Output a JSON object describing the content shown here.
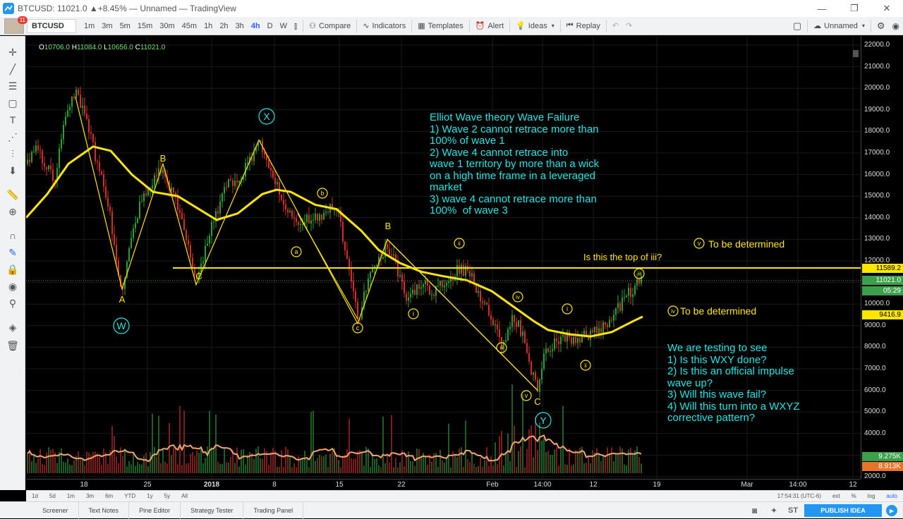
{
  "window": {
    "title": "BTCUSD: 11021.0 ▲+8.45% — Unnamed — TradingView",
    "minimize": "—",
    "maximize": "❐",
    "close": "✕"
  },
  "account": {
    "notification_count": "11"
  },
  "toolbar": {
    "symbol": "BTCUSD",
    "intervals": [
      "1m",
      "3m",
      "5m",
      "15m",
      "30m",
      "45m",
      "1h",
      "2h",
      "3h",
      "4h",
      "D",
      "W"
    ],
    "active_interval": "4h",
    "compare": "Compare",
    "indicators": "Indicators",
    "templates": "Templates",
    "alert": "Alert",
    "ideas": "Ideas",
    "replay": "Replay",
    "layout_name": "Unnamed"
  },
  "legend": {
    "o": "O",
    "o_val": "10706.0",
    "h": "H",
    "h_val": "11084.0",
    "l": "L",
    "l_val": "10656.0",
    "c": "C",
    "c_val": "11021.0"
  },
  "annotations": {
    "theory": "Elliot Wave theory Wave Failure\n1) Wave 2 cannot retrace more than\n100% of wave 1\n2) Wave 4 cannot retrace into\nwave 1 territory by more than a wick\non a high time frame in a leveraged\nmarket\n3) wave 4 cannot retrace more than\n100%  of wave 3",
    "testing": "We are testing to see\n1) Is this WXY done?\n2) Is this an official impulse\nwave up?\n3) Will this wave fail?\n4) Will this turn into a WXYZ\ncorrective pattern?",
    "top_question": "Is this the top of iii?",
    "v_tbd": "To be determined",
    "iv_tbd": "To be determined"
  },
  "wave_labels": {
    "X": "X",
    "W": "W",
    "Y": "Y",
    "A1": "A",
    "B1": "B",
    "C1": "C",
    "B2": "B",
    "C2": "C",
    "a": "a",
    "b": "b",
    "c": "c",
    "i1": "i",
    "ii1": "ii",
    "iii1": "iii",
    "iv1": "iv",
    "v1": "v",
    "i2": "i",
    "ii2": "ii",
    "iii2": "iii",
    "iv2": "iv",
    "v2": "v"
  },
  "price_axis": {
    "ticks": [
      "22000.0",
      "21000.0",
      "20000.0",
      "19000.0",
      "18000.0",
      "17000.0",
      "16000.0",
      "15000.0",
      "14000.0",
      "13000.0",
      "12000.0",
      "10000.0",
      "9000.0",
      "8000.0",
      "7000.0",
      "6000.0",
      "5000.0",
      "4000.0",
      "2000.0"
    ],
    "line_price": "11589.2",
    "last_price": "11021.0",
    "countdown": "05:29",
    "ma_price": "9416.9",
    "vol1": "9.275K",
    "vol2": "8.913K"
  },
  "time_axis": {
    "ticks": [
      "18",
      "25",
      "2018",
      "8",
      "15",
      "22",
      "Feb",
      "14:00",
      "12",
      "19",
      "Mar",
      "14:00",
      "12"
    ]
  },
  "ranges": {
    "items": [
      "1d",
      "5d",
      "1m",
      "3m",
      "6m",
      "YTD",
      "1y",
      "5y",
      "All"
    ],
    "clock": "17:54:31 (UTC-6)",
    "ext": "ext",
    "pct": "%",
    "log": "log",
    "auto": "auto"
  },
  "bottom": {
    "tabs": [
      "Screener",
      "Text Notes",
      "Pine Editor",
      "Strategy Tester",
      "Trading Panel"
    ],
    "st": "ST",
    "publish": "PUBLISH IDEA"
  },
  "colors": {
    "background": "#000000",
    "annotation": "#21e6e6",
    "wave": "#ffe600",
    "up_candle": "#2e9e3a",
    "down_candle": "#d32f2f",
    "volume_ma": "#f2a46c"
  },
  "chart_data": {
    "type": "candlestick",
    "ylim": [
      2000,
      22000
    ],
    "moving_average_end": 9416.9,
    "horizontal_line": 11589.2,
    "last_close": 11021.0,
    "x": [
      "18",
      "25",
      "2018",
      "8",
      "15",
      "22",
      "Feb",
      "14:00",
      "12",
      "19",
      "Mar",
      "14:00",
      "12"
    ]
  }
}
